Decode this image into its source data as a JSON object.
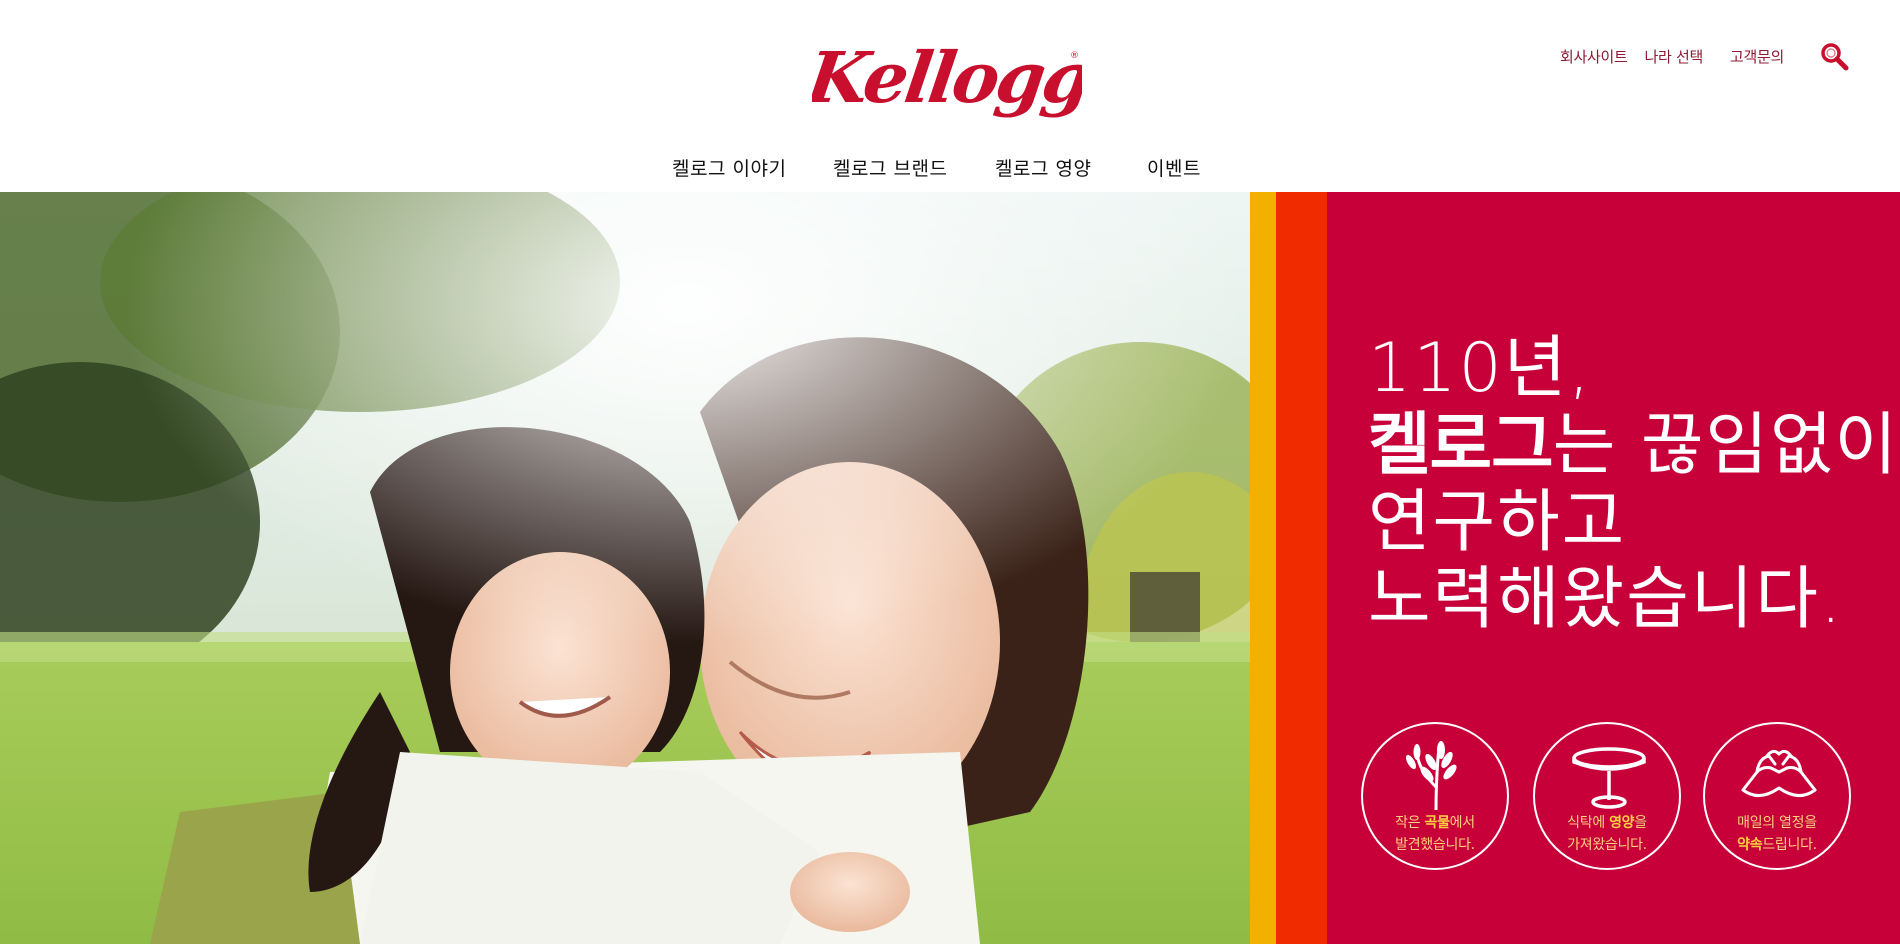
{
  "brand": {
    "logo_text": "Kellogg's",
    "logo_color": "#c8102e"
  },
  "util_nav": {
    "company_site": "회사사이트",
    "country_select": "나라 선택",
    "customer_inquiry": "고객문의"
  },
  "search": {
    "icon": "search-icon",
    "color": "#c8102e"
  },
  "main_nav": [
    {
      "label": "켈로그 이야기"
    },
    {
      "label": "켈로그 브랜드"
    },
    {
      "label": "켈로그 영양"
    },
    {
      "label": "이벤트"
    }
  ],
  "hero": {
    "headline": {
      "line1": "110년,",
      "line2_bold": "켈로그",
      "line2_rest": "는 끊임없이",
      "line3": "연구하고",
      "line4": "노력해왔습니다."
    },
    "badges": [
      {
        "icon": "wheat-icon",
        "pre": "작은 ",
        "strong": "곡물",
        "post": "에서",
        "line2": "발견했습니다."
      },
      {
        "icon": "table-icon",
        "pre": "식탁에 ",
        "strong": "영양",
        "post": "을",
        "line2": "가져왔습니다."
      },
      {
        "icon": "pinky-promise-icon",
        "pre": "매일의 열정을",
        "strong": "",
        "post": "",
        "line2_strong": "약속",
        "line2": "드립니다."
      }
    ],
    "colors": {
      "yellow": "#f2b000",
      "orange": "#f12b00",
      "red": "#c8003a",
      "badge_text": "#f8d27c"
    }
  }
}
